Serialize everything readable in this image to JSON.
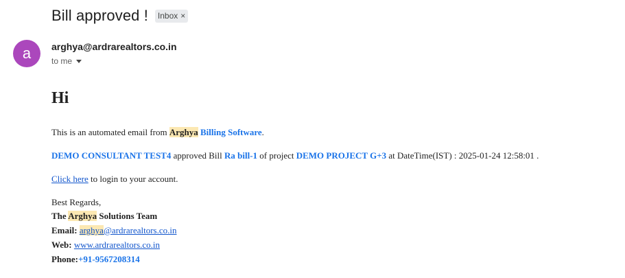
{
  "subject": "Bill approved !",
  "label_chip": {
    "text": "Inbox",
    "close": "×"
  },
  "sender": {
    "avatar_letter": "a",
    "email": "arghya@ardrarealtors.co.in",
    "to_text": "to me"
  },
  "colors": {
    "avatar": "#ab47bc",
    "link": "#1155cc",
    "accent": "#1a73e8",
    "highlight": "#fce8b2"
  },
  "mail": {
    "greeting": "Hi",
    "intro": {
      "pre": "This is an automated email from ",
      "brand": "Arghya",
      "brand_rest": "Billing Software",
      "post": "."
    },
    "approval": {
      "consultant": "DEMO CONSULTANT TEST4",
      "t1": " approved Bill ",
      "bill": "Ra bill-1",
      "t2": " of project ",
      "project": "DEMO PROJECT G+3",
      "t3": " at DateTime(IST) : 2025-01-24 12:58:01 ."
    },
    "login": {
      "link": "Click here",
      "rest": " to login to your account."
    },
    "signoff": "Best Regards,",
    "team": {
      "pre": "The ",
      "brand": "Arghya",
      "post": " Solutions Team"
    },
    "email_line": {
      "label": "Email: ",
      "local": "arghya",
      "domain": "@ardrarealtors.co.in"
    },
    "web_line": {
      "label": "Web: ",
      "value": "www.ardrarealtors.co.in"
    },
    "phone_line": {
      "label": "Phone:",
      "value": "+91-9567208314"
    }
  }
}
